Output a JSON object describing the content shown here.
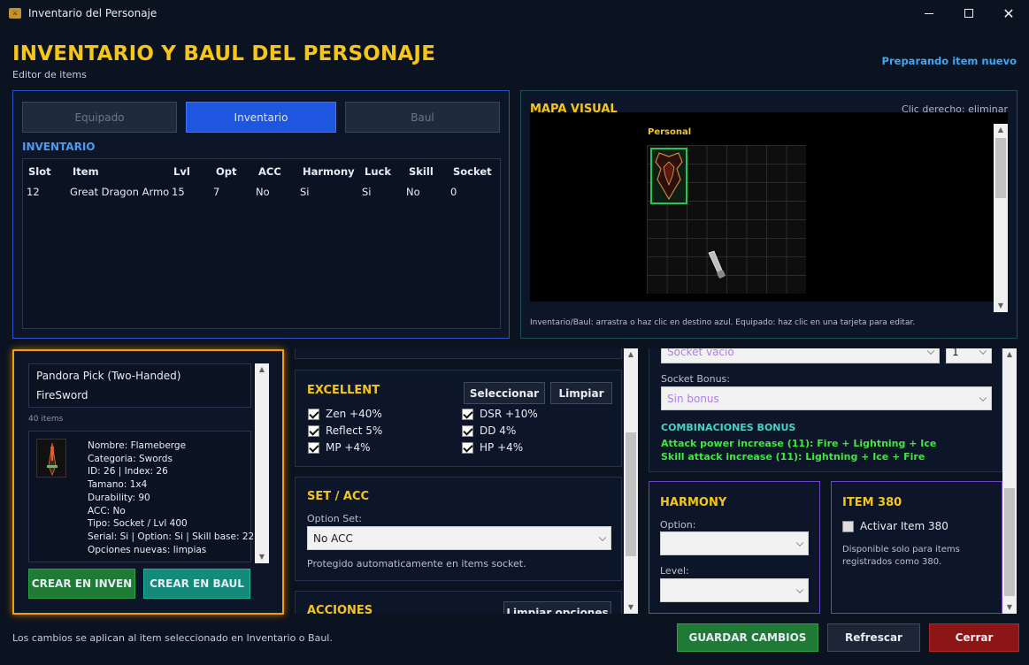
{
  "window": {
    "title": "Inventario del Personaje",
    "icon": "app-icon"
  },
  "header": {
    "title": "INVENTARIO Y BAUL DEL PERSONAJE",
    "subtitle": "Editor de items",
    "status": "Preparando item nuevo"
  },
  "tabs": [
    {
      "label": "Equipado"
    },
    {
      "label": "Inventario"
    },
    {
      "label": "Baul"
    }
  ],
  "inventory": {
    "title": "INVENTARIO",
    "columns": [
      "Slot",
      "Item",
      "Lvl",
      "Opt",
      "ACC",
      "Harmony",
      "Luck",
      "Skill",
      "Socket"
    ],
    "rows": [
      [
        "12",
        "Great Dragon Armor",
        "15",
        "7",
        "No",
        "Si",
        "Si",
        "No",
        "0"
      ]
    ]
  },
  "map": {
    "title": "MAPA VISUAL",
    "hint": "Clic derecho: eliminar",
    "section_label": "Personal",
    "footer": "Inventario/Baul: arrastra o haz clic en destino azul. Equipado: haz clic en una tarjeta para editar."
  },
  "item_list": {
    "items": [
      "Pandora Pick (Two-Handed)",
      "FireSword"
    ],
    "count": "40 items"
  },
  "item_detail": [
    "Nombre: Flameberge",
    "Categoria: Swords",
    "ID: 26 | Index: 26",
    "Tamano: 1x4",
    "Durability: 90",
    "ACC: No",
    "Tipo: Socket / Lvl 400",
    "Serial: Si | Option: Si | Skill base: 22",
    "Opciones nuevas: limpias"
  ],
  "create_buttons": {
    "inv": "CREAR EN INVEN",
    "baul": "CREAR EN BAUL"
  },
  "excellent": {
    "title": "EXCELLENT",
    "select": "Seleccionar",
    "clear": "Limpiar",
    "options": [
      {
        "label": "Zen +40%",
        "checked": true
      },
      {
        "label": "DSR +10%",
        "checked": true
      },
      {
        "label": "Reflect 5%",
        "checked": true
      },
      {
        "label": "DD 4%",
        "checked": true
      },
      {
        "label": "MP +4%",
        "checked": true
      },
      {
        "label": "HP +4%",
        "checked": true
      }
    ]
  },
  "set_acc": {
    "title": "SET / ACC",
    "option_label": "Option Set:",
    "option_value": "No ACC",
    "note": "Protegido automaticamente en items socket."
  },
  "acciones": {
    "title": "ACCIONES",
    "clear_options": "Limpiar opciones"
  },
  "socket": {
    "slot_value": "Socket vacio",
    "count_value": "1",
    "bonus_label": "Socket Bonus:",
    "bonus_value": "Sin bonus",
    "combos_title": "COMBINACIONES BONUS",
    "combos": [
      "Attack power increase (11): Fire + Lightning + Ice",
      "Skill attack increase (11): Lightning + Ice + Fire"
    ]
  },
  "harmony": {
    "title": "HARMONY",
    "option_label": "Option:",
    "level_label": "Level:"
  },
  "item380": {
    "title": "ITEM 380",
    "check_label": "Activar Item 380",
    "note": "Disponible solo para items registrados como 380."
  },
  "footer": {
    "note": "Los cambios se aplican al item seleccionado en Inventario o Baul.",
    "save": "GUARDAR CAMBIOS",
    "refresh": "Refrescar",
    "close": "Cerrar"
  },
  "colors": {
    "accent_gold": "#f5c518",
    "accent_blue": "#1f56e0",
    "green": "#1e7a34",
    "teal": "#138a7a",
    "red": "#8c1515",
    "combo_green": "#3ee83e"
  }
}
